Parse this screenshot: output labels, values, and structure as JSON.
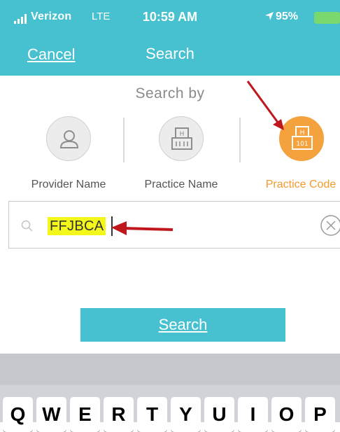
{
  "status_bar": {
    "carrier": "Verizon",
    "network": "LTE",
    "time": "10:59 AM",
    "battery": "95%"
  },
  "nav": {
    "cancel": "Cancel",
    "title": "Search"
  },
  "search_by": {
    "heading": "Search by",
    "options": [
      {
        "label": "Provider Name",
        "icon": "person-icon",
        "selected": false
      },
      {
        "label": "Practice Name",
        "icon": "building-icon",
        "selected": false
      },
      {
        "label": "Practice Code",
        "icon": "building-code-icon",
        "selected": true
      }
    ],
    "code_badge": "101",
    "building_glyph": "H"
  },
  "search_field": {
    "value": "FFJBCA",
    "highlight_color": "#f3f71a"
  },
  "search_button": {
    "label": "Search"
  },
  "keyboard": {
    "keys": [
      "Q",
      "W",
      "E",
      "R",
      "T",
      "Y",
      "U",
      "I",
      "O",
      "P"
    ]
  },
  "colors": {
    "header": "#47c1cf",
    "accent_orange": "#f3a23d",
    "annotation_arrow": "#c0171f"
  }
}
